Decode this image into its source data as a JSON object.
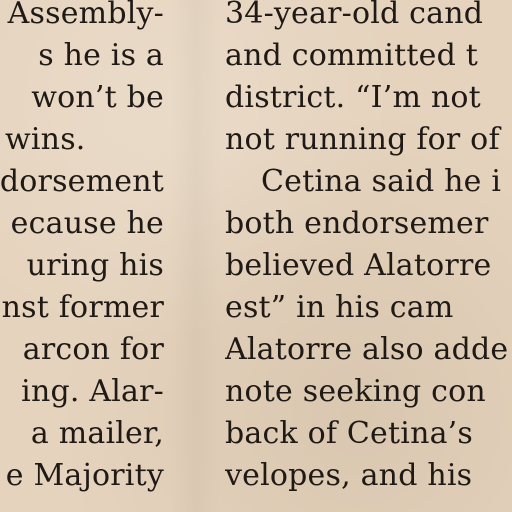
{
  "left_column": {
    "lines": [
      "Assembly-",
      "s he is a",
      "won’t be",
      "wins.",
      "dorsement",
      "ecause he",
      "uring his",
      "nst former",
      "arcon for",
      "ing. Alar-",
      "a mailer,",
      "e Majority"
    ]
  },
  "right_column": {
    "lines": [
      "34-year-old cand",
      "and committed t",
      "district. “I’m not",
      "not running for of",
      "Cetina said he i",
      "both endorsemer",
      "believed Alatorre",
      "est” in his cam",
      "Alatorre also adde",
      "note seeking con",
      "back of Cetina’s",
      "velopes, and his"
    ]
  }
}
